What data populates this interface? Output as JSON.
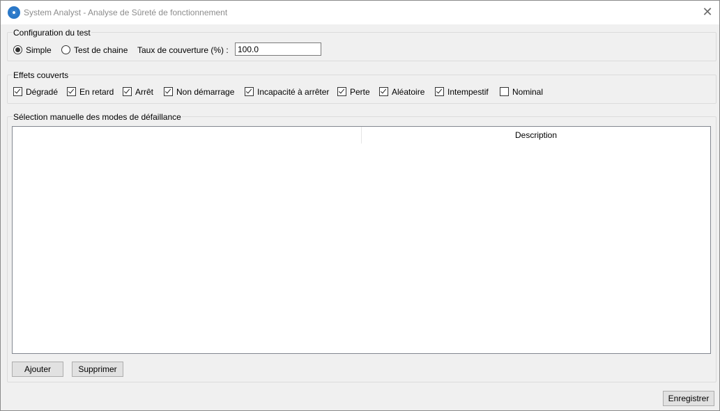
{
  "window": {
    "title": "System Analyst - Analyse de Sûreté de fonctionnement",
    "close_symbol": "✕"
  },
  "config": {
    "legend": "Configuration du test",
    "options": [
      {
        "label": "Simple",
        "selected": true
      },
      {
        "label": "Test de chaine",
        "selected": false
      }
    ],
    "coverage_label": "Taux de couverture (%) :",
    "coverage_value": "100.0"
  },
  "effects": {
    "legend": "Effets couverts",
    "items": [
      {
        "label": "Dégradé",
        "checked": true
      },
      {
        "label": "En retard",
        "checked": true
      },
      {
        "label": "Arrêt",
        "checked": true
      },
      {
        "label": "Non démarrage",
        "checked": true
      },
      {
        "label": "Incapacité à arrêter",
        "checked": true
      },
      {
        "label": "Perte",
        "checked": true
      },
      {
        "label": "Aléatoire",
        "checked": true
      },
      {
        "label": "Intempestif",
        "checked": true
      },
      {
        "label": "Nominal",
        "checked": false
      }
    ]
  },
  "failure_modes": {
    "legend": "Sélection manuelle des modes de défaillance",
    "columns": [
      "",
      "Description"
    ],
    "add_label": "Ajouter",
    "delete_label": "Supprimer"
  },
  "footer": {
    "save_label": "Enregistrer"
  }
}
